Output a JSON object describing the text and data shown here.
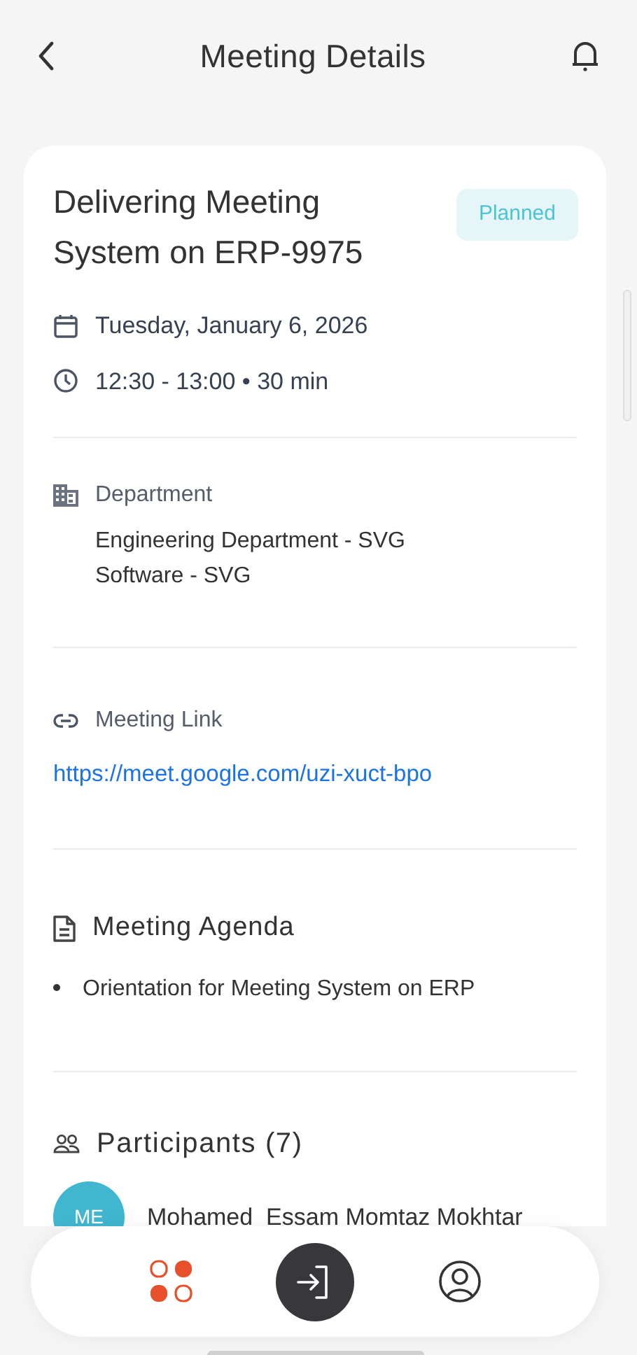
{
  "header": {
    "title": "Meeting Details"
  },
  "meeting": {
    "title": "Delivering Meeting System on ERP-9975",
    "status": "Planned",
    "date": "Tuesday, January 6, 2026",
    "time": "12:30 - 13:00 • 30 min"
  },
  "department": {
    "label": "Department",
    "value": "Engineering Department - SVG Software - SVG"
  },
  "meeting_link": {
    "label": "Meeting Link",
    "url": "https://meet.google.com/uzi-xuct-bpo"
  },
  "agenda": {
    "title": "Meeting Agenda",
    "items": [
      "Orientation for Meeting System on ERP"
    ]
  },
  "participants": {
    "title": "Participants (7)",
    "items": [
      {
        "initials": "ME",
        "name": "Mohamed  Essam Momtaz Mokhtar",
        "color": "#41b6cf"
      }
    ]
  },
  "bottom_nav": [
    {
      "kind": "apps",
      "selected": true
    },
    {
      "kind": "enter",
      "selected": false
    },
    {
      "kind": "profile",
      "selected": false
    }
  ]
}
